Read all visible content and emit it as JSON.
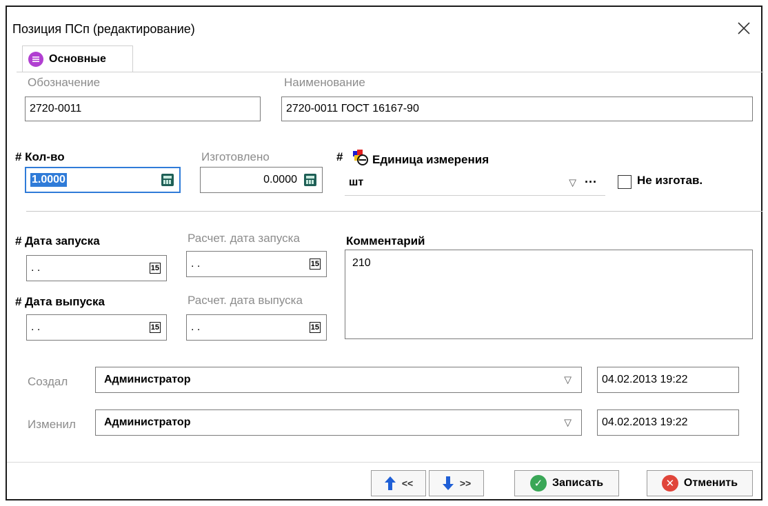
{
  "window": {
    "title": "Позиция ПСп (редактирование)"
  },
  "tabs": [
    {
      "label": "Основные",
      "icon": "list-icon"
    }
  ],
  "fields": {
    "designation": {
      "label": "Обозначение",
      "value": "2720-0011"
    },
    "name": {
      "label": "Наименование",
      "value": "2720-0011 ГОСТ 16167-90"
    },
    "quantity": {
      "label": "# Кол-во",
      "value": "1.0000"
    },
    "manufactured": {
      "label": "Изготовлено",
      "value": "0.0000"
    },
    "unit": {
      "label_prefix": "#",
      "label": "Единица измерения",
      "value": "шт",
      "more": "···"
    },
    "not_manufactured": {
      "label": "Не изготав.",
      "checked": false
    },
    "start_date": {
      "label": "# Дата запуска",
      "value": ". ."
    },
    "calc_start_date": {
      "label": "Расчет. дата запуска",
      "value": ". ."
    },
    "release_date": {
      "label": "# Дата выпуска",
      "value": ". ."
    },
    "calc_release_date": {
      "label": "Расчет. дата выпуска",
      "value": ". ."
    },
    "comment": {
      "label": "Комментарий",
      "value": "210"
    },
    "created_by": {
      "label": "Создал",
      "value": "Администратор",
      "timestamp": "04.02.2013 19:22"
    },
    "modified_by": {
      "label": "Изменил",
      "value": "Администратор",
      "timestamp": "04.02.2013 19:22"
    }
  },
  "calendar_icon_text": "15",
  "buttons": {
    "prev": "<<",
    "next": ">>",
    "save": "Записать",
    "cancel": "Отменить"
  },
  "colors": {
    "accent": "#2f7bd8",
    "tab_icon": "#b13fd1",
    "save_icon": "#3aa757",
    "cancel_icon": "#e0453a",
    "arrow_blue": "#1f5fd6"
  }
}
